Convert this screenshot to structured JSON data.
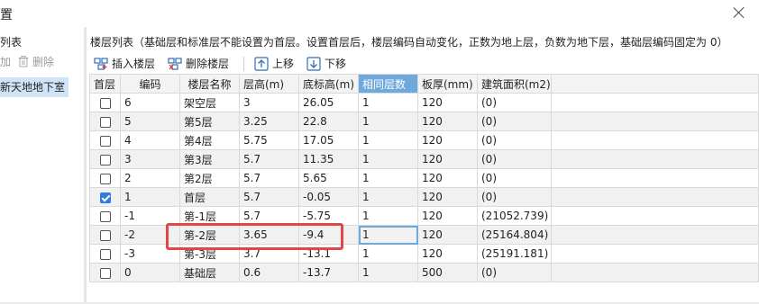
{
  "window": {
    "title": "置"
  },
  "left_panel": {
    "title": "列表",
    "add_label": "加",
    "delete_label": "删除",
    "selected_project": "新天地地下室"
  },
  "right_panel": {
    "description": "楼层列表（基础层和标准层不能设置为首层。设置首层后，楼层编码自动变化，正数为地上层，负数为地下层，基础层编码固定为 0）",
    "toolbar": {
      "insert": "插入楼层",
      "delete": "删除楼层",
      "move_up": "上移",
      "move_down": "下移"
    },
    "columns": [
      "首层",
      "编码",
      "楼层名称",
      "层高(m)",
      "底标高(m)",
      "相同层数",
      "板厚(mm)",
      "建筑面积(m2)"
    ],
    "rows": [
      {
        "first": false,
        "code": "6",
        "name": "架空层",
        "height": "3",
        "base": "26.05",
        "same": "1",
        "slab": "120",
        "area": "(0)"
      },
      {
        "first": false,
        "code": "5",
        "name": "第5层",
        "height": "3.25",
        "base": "22.8",
        "same": "1",
        "slab": "120",
        "area": "(0)"
      },
      {
        "first": false,
        "code": "4",
        "name": "第4层",
        "height": "5.75",
        "base": "17.05",
        "same": "1",
        "slab": "120",
        "area": "(0)"
      },
      {
        "first": false,
        "code": "3",
        "name": "第3层",
        "height": "5.7",
        "base": "11.35",
        "same": "1",
        "slab": "120",
        "area": "(0)"
      },
      {
        "first": false,
        "code": "2",
        "name": "第2层",
        "height": "5.7",
        "base": "5.65",
        "same": "1",
        "slab": "120",
        "area": "(0)"
      },
      {
        "first": true,
        "code": "1",
        "name": "首层",
        "height": "5.7",
        "base": "-0.05",
        "same": "1",
        "slab": "120",
        "area": "(0)"
      },
      {
        "first": false,
        "code": "-1",
        "name": "第-1层",
        "height": "5.7",
        "base": "-5.75",
        "same": "1",
        "slab": "120",
        "area": "(21052.739)"
      },
      {
        "first": false,
        "code": "-2",
        "name": "第-2层",
        "height": "3.65",
        "base": "-9.4",
        "same": "1",
        "slab": "120",
        "area": "(25164.804)"
      },
      {
        "first": false,
        "code": "-3",
        "name": "第-3层",
        "height": "3.7",
        "base": "-13.1",
        "same": "1",
        "slab": "120",
        "area": "(25191.181)"
      },
      {
        "first": false,
        "code": "0",
        "name": "基础层",
        "height": "0.6",
        "base": "-13.7",
        "same": "1",
        "slab": "500",
        "area": "(0)"
      }
    ]
  },
  "colors": {
    "active_column": "#6fa8dc",
    "selected_item": "#cfe4f7",
    "highlight_box": "#e04848"
  }
}
